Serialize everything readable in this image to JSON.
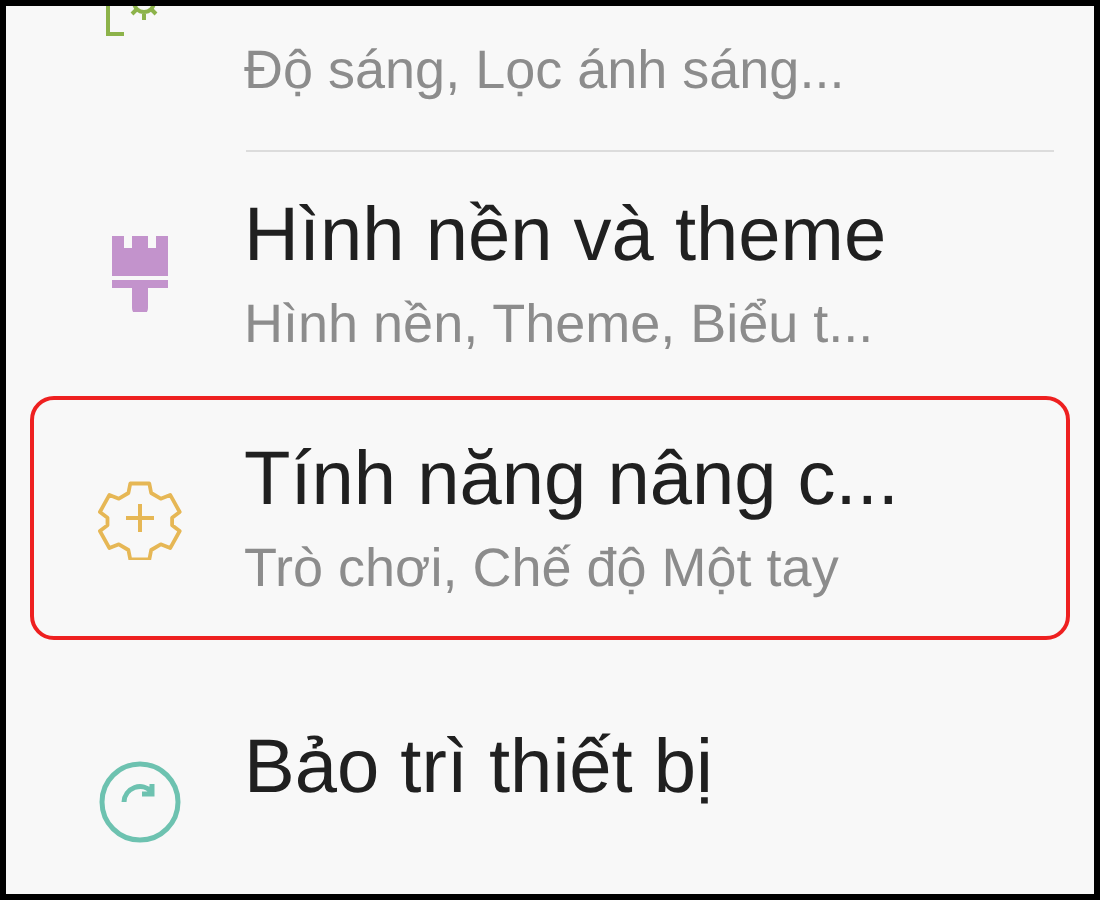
{
  "settings_items": [
    {
      "subtitle": "Độ sáng, Lọc ánh sáng...",
      "selected": false
    },
    {
      "title": "Hình nền và theme",
      "subtitle": "Hình nền, Theme, Biểu t...",
      "selected": false
    },
    {
      "title": "Tính năng nâng c...",
      "subtitle": "Trò chơi, Chế độ Một tay",
      "selected": true
    },
    {
      "title": "Bảo trì thiết bị",
      "selected": false
    }
  ]
}
